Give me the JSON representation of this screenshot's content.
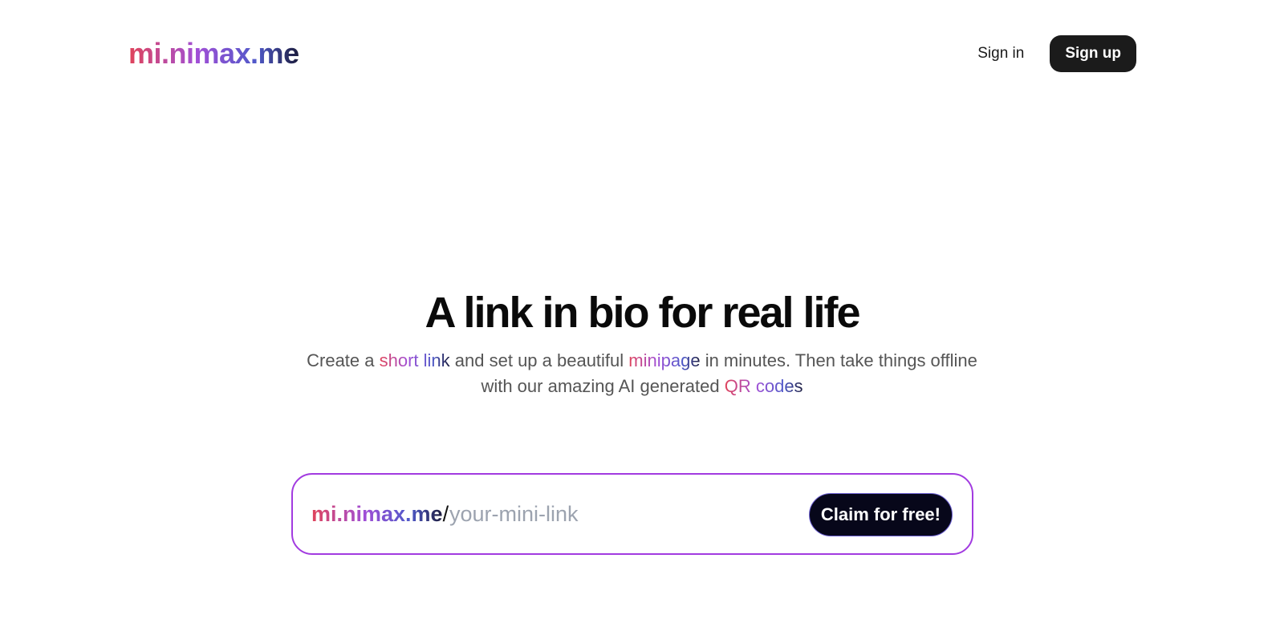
{
  "header": {
    "logo": "mi.nimax.me",
    "sign_in": "Sign in",
    "sign_up": "Sign up"
  },
  "hero": {
    "title": "A link in bio for real life",
    "subtitle_parts": {
      "p1": "Create a ",
      "short_link": "short link",
      "p2": " and set up a beautiful ",
      "minipage": "minipage",
      "p3": " in minutes. Then take things offline with our amazing AI generated ",
      "qr_codes": "QR codes"
    }
  },
  "claim": {
    "prefix": "mi.nimax.me",
    "slash": "/",
    "placeholder": "your-mini-link",
    "button": "Claim for free!"
  },
  "colors": {
    "gradient_start": "#e0445a",
    "gradient_mid": "#a14fd6",
    "gradient_mid2": "#4f59c9",
    "gradient_end": "#1c1c3c",
    "claim_border": "#a23be0",
    "button_dark": "#1b1b1b"
  }
}
